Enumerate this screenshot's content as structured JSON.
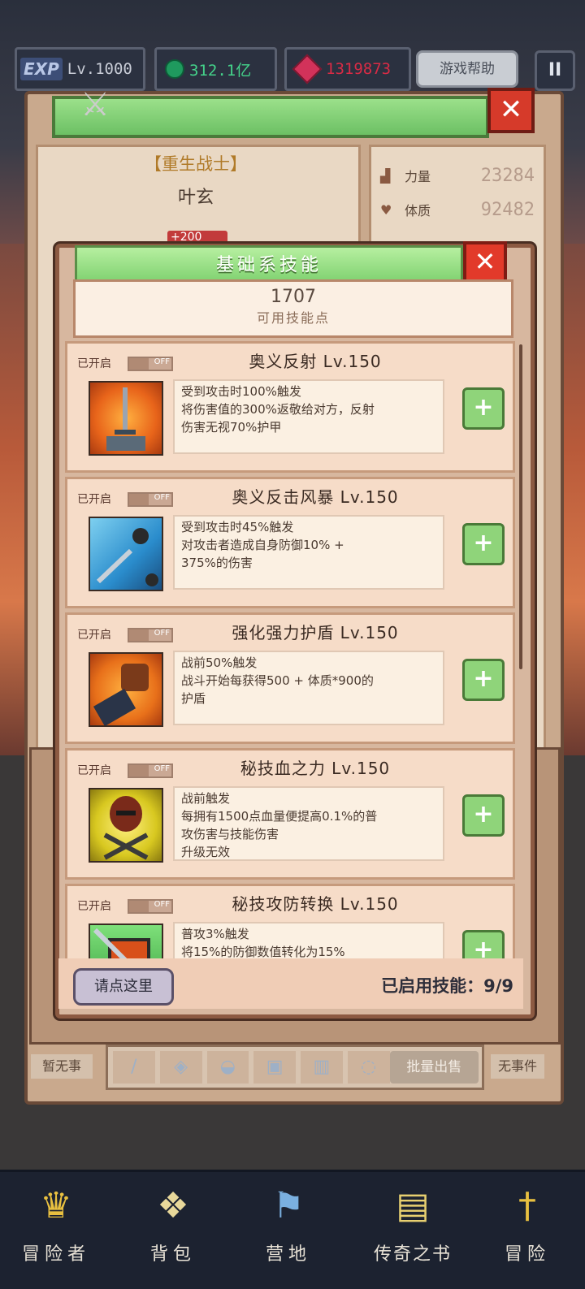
{
  "hud": {
    "exp_badge": "EXP",
    "level": "Lv.1000",
    "coins": "312.1亿",
    "gems": "1319873",
    "help_label": "游戏帮助",
    "pause_label": "II"
  },
  "character": {
    "class": "【重生战士】",
    "name": "叶玄",
    "bonus": "+200",
    "stats": [
      {
        "label": "力量",
        "value": "23284"
      },
      {
        "label": "体质",
        "value": "92482"
      }
    ]
  },
  "lower": {
    "left_tag": "暂无事",
    "right_tag": "无事件",
    "batch_label": "批量出售"
  },
  "modal": {
    "title": "基础系技能",
    "points_value": "1707",
    "points_label": "可用技能点",
    "skills": [
      {
        "status": "已开启",
        "toggle": "OFF",
        "name": "奥义反射 Lv.150",
        "desc": [
          "受到攻击时100%触发",
          "将伤害值的300%返敬给对方，反射",
          "伤害无视70%护甲"
        ],
        "icon": "sword-icon",
        "icon_bg": "#e8641a"
      },
      {
        "status": "已开启",
        "toggle": "OFF",
        "name": "奥义反击风暴 Lv.150",
        "desc": [
          "受到攻击时45%触发",
          "对攻击者造成自身防御10% +",
          "375%的伤害"
        ],
        "icon": "storm-icon",
        "icon_bg": "#2a8ccc"
      },
      {
        "status": "已开启",
        "toggle": "OFF",
        "name": "强化强力护盾 Lv.150",
        "desc": [
          "战前50%触发",
          "战斗开始每获得500 + 体质*900的",
          "护盾"
        ],
        "icon": "fist-icon",
        "icon_bg": "#e8701a"
      },
      {
        "status": "已开启",
        "toggle": "OFF",
        "name": "秘技血之力 Lv.150",
        "desc": [
          "战前触发",
          "每拥有1500点血量便提高0.1%的普",
          "攻伤害与技能伤害",
          "升级无效"
        ],
        "icon": "helmet-icon",
        "icon_bg": "#d8c820"
      },
      {
        "status": "已开启",
        "toggle": "OFF",
        "name": "秘技攻防转换 Lv.150",
        "desc": [
          "普攻3%触发",
          "将15%的防御数值转化为15%"
        ],
        "icon": "shield-sword-icon",
        "icon_bg": "#3aa040"
      }
    ],
    "click_here": "请点这里",
    "enabled_skills": "已启用技能：9/9"
  },
  "nav": [
    {
      "label": "冒险者",
      "icon": "crown-icon"
    },
    {
      "label": "背包",
      "icon": "bag-icon"
    },
    {
      "label": "营地",
      "icon": "banner-icon"
    },
    {
      "label": "传奇之书",
      "icon": "book-icon"
    },
    {
      "label": "冒险",
      "icon": "dagger-icon"
    }
  ]
}
